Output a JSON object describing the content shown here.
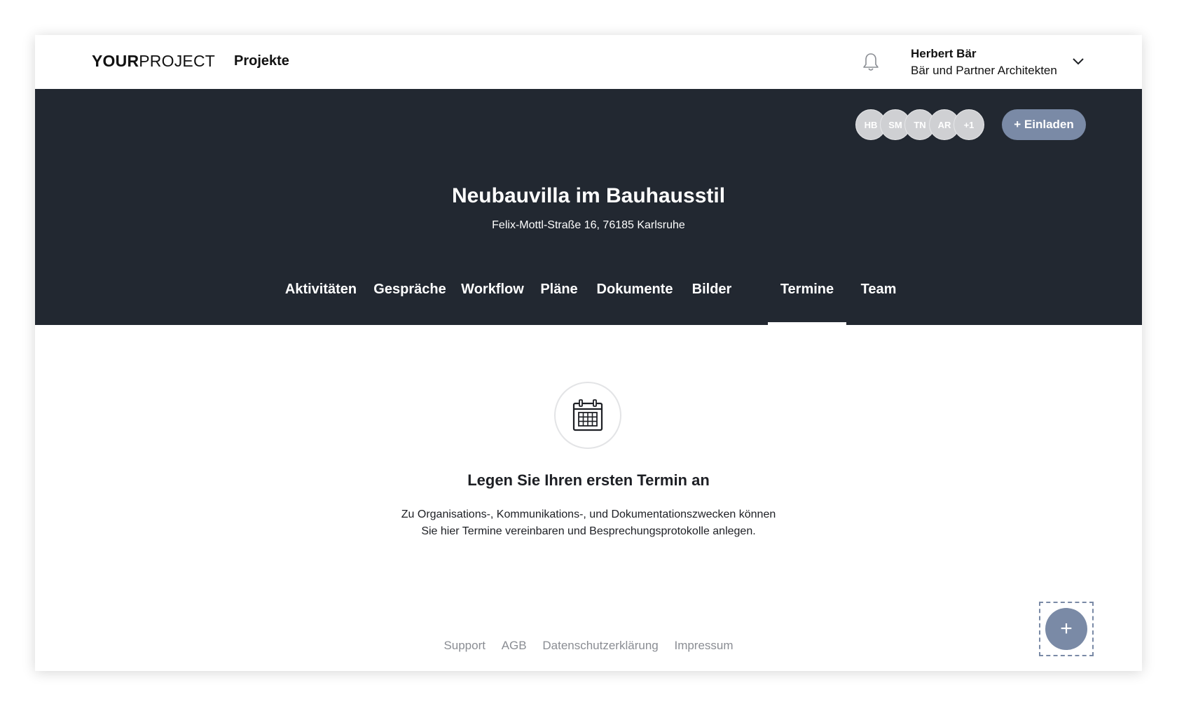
{
  "header": {
    "logo_bold": "YOUR",
    "logo_light": "PROJECT",
    "nav_projects": "Projekte",
    "user_name": "Herbert Bär",
    "user_company": "Bär und Partner Architekten"
  },
  "project": {
    "title": "Neubauvilla im Bauhausstil",
    "address": "Felix-Mottl-Straße 16, 76185 Karlsruhe",
    "members": [
      "HB",
      "SM",
      "TN",
      "AR",
      "+1"
    ],
    "invite_label": "+ Einladen"
  },
  "tabs": [
    {
      "label": "Aktivitäten",
      "active": false
    },
    {
      "label": "Gespräche",
      "active": false
    },
    {
      "label": "Workflow",
      "active": false
    },
    {
      "label": "Pläne",
      "active": false
    },
    {
      "label": "Dokumente",
      "active": false
    },
    {
      "label": "Bilder",
      "active": false
    },
    {
      "label": "Termine",
      "active": true
    },
    {
      "label": "Team",
      "active": false
    }
  ],
  "empty_state": {
    "icon": "calendar-icon",
    "title": "Legen Sie Ihren ersten Termin an",
    "line1": "Zu Organisations-, Kommunikations-, und Dokumentationszwecken können",
    "line2": "Sie hier Termine vereinbaren und Besprechungsprotokolle anlegen."
  },
  "footer": {
    "links": [
      "Support",
      "AGB",
      "Datenschutzerklärung",
      "Impressum"
    ]
  },
  "fab": {
    "label": "+"
  },
  "colors": {
    "hero_bg": "#222831",
    "accent": "#7a8aa6",
    "avatar_bg": "#cfd0d3",
    "footer_text": "#8a8d93"
  }
}
